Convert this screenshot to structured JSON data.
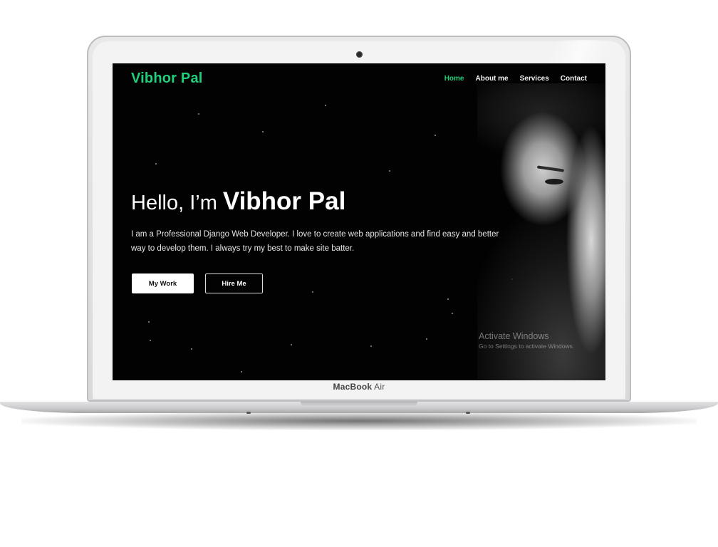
{
  "site": {
    "logo": "Vibhor Pal",
    "nav": [
      "Home",
      "About me",
      "Services",
      "Contact"
    ],
    "active_nav": "Home",
    "hero": {
      "greeting": "Hello, I’m",
      "name": "Vibhor Pal",
      "description": "I am a Professional Django Web Developer. I love to create web applications and find easy and better way to develop them. I always try my best to make site batter.",
      "buttons": {
        "primary": "My Work",
        "secondary": "Hire Me"
      }
    },
    "watermark": {
      "title": "Activate Windows",
      "subtitle": "Go to Settings to activate Windows."
    }
  },
  "device": {
    "brand_bold": "MacBook",
    "brand_rest": " Air"
  },
  "colors": {
    "accent": "#1fcf7a",
    "background": "#020202",
    "text": "#ffffff"
  }
}
